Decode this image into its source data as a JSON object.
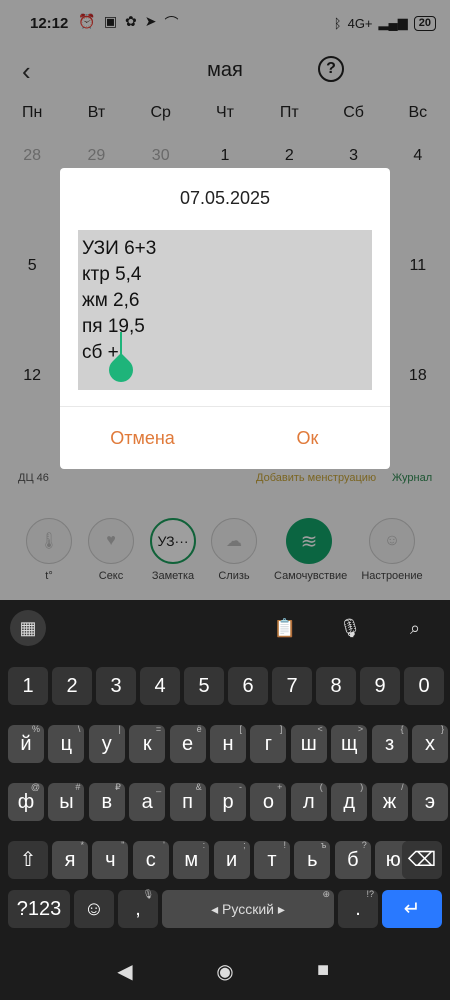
{
  "status_bar": {
    "time": "12:12",
    "left_icons": [
      "alarm-icon",
      "nfc-icon",
      "apps-icon",
      "telegram-icon",
      "arc-icon"
    ],
    "signal": "4G+",
    "battery": "20"
  },
  "header": {
    "month": "мая",
    "help": "?"
  },
  "weekdays": [
    "Пн",
    "Вт",
    "Ср",
    "Чт",
    "Пт",
    "Сб",
    "Вс"
  ],
  "weeks": [
    [
      "28",
      "29",
      "30",
      "1",
      "2",
      "3",
      "4"
    ],
    [
      "5",
      "",
      "",
      "",
      "",
      "",
      "11"
    ],
    [
      "12",
      "",
      "",
      "",
      "",
      "",
      "18"
    ]
  ],
  "legend": {
    "dc": "ДЦ 46",
    "add_menstruation": "Добавить менструацию",
    "journal": "Журнал"
  },
  "log_icons": [
    {
      "label": "t°",
      "icon": "thermometer-icon"
    },
    {
      "label": "Секс",
      "icon": "heart-icon"
    },
    {
      "label": "Заметка",
      "icon": "note-icon",
      "value": "УЗ···"
    },
    {
      "label": "Слизь",
      "icon": "cloud-icon"
    },
    {
      "label": "Самочувствие",
      "icon": "wave-icon"
    },
    {
      "label": "Настроение",
      "icon": "smile-icon"
    }
  ],
  "dialog": {
    "title": "07.05.2025",
    "text": "УЗИ 6+3\nктр 5,4\nжм 2,6\nпя 19,5\nсб +",
    "cancel": "Отмена",
    "ok": "Ок"
  },
  "keyboard": {
    "row_digits": [
      "1",
      "2",
      "3",
      "4",
      "5",
      "6",
      "7",
      "8",
      "9",
      "0"
    ],
    "row1": [
      [
        "й",
        "%"
      ],
      [
        "ц",
        "\\"
      ],
      [
        "у",
        "|"
      ],
      [
        "к",
        "="
      ],
      [
        "е",
        "ё"
      ],
      [
        "н",
        "["
      ],
      [
        "г",
        "]"
      ],
      [
        "ш",
        "<"
      ],
      [
        "щ",
        ">"
      ],
      [
        "з",
        "{"
      ],
      [
        "х",
        "}"
      ]
    ],
    "row2": [
      [
        "ф",
        "@"
      ],
      [
        "ы",
        "#"
      ],
      [
        "в",
        "₽"
      ],
      [
        "а",
        "_"
      ],
      [
        "п",
        "&"
      ],
      [
        "р",
        "-"
      ],
      [
        "о",
        "+"
      ],
      [
        "л",
        "("
      ],
      [
        "д",
        ")"
      ],
      [
        "ж",
        "/"
      ],
      [
        "э",
        ""
      ]
    ],
    "row3": [
      [
        "я",
        "*"
      ],
      [
        "ч",
        "\""
      ],
      [
        "с",
        "'"
      ],
      [
        "м",
        ":"
      ],
      [
        "и",
        ";"
      ],
      [
        "т",
        "!"
      ],
      [
        "ь",
        "ъ"
      ],
      [
        "б",
        "?"
      ],
      [
        "ю",
        ""
      ]
    ],
    "symbols": "?123",
    "space": "Русский",
    "comma": ",",
    "period": ".",
    "period_hint": "!?"
  },
  "colors": {
    "accent_orange": "#e07a3a",
    "accent_green": "#1eb47a",
    "enter_blue": "#2979ff"
  }
}
